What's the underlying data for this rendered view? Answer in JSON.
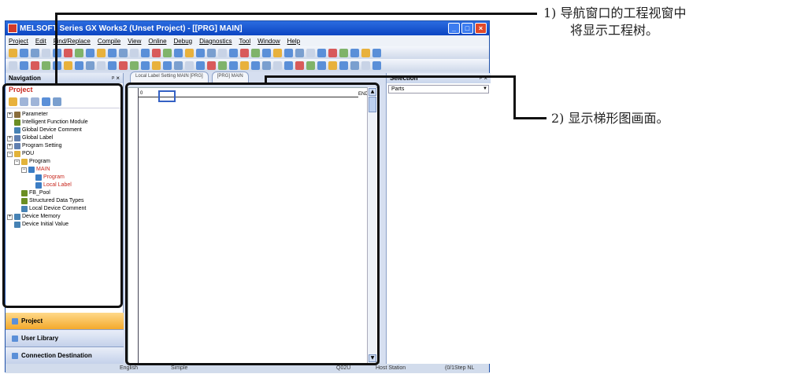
{
  "window": {
    "title": "MELSOFT Series GX Works2 (Unset Project) - [[PRG] MAIN]"
  },
  "menu": [
    "Project",
    "Edit",
    "Find/Replace",
    "Compile",
    "View",
    "Online",
    "Debug",
    "Diagnostics",
    "Tool",
    "Window",
    "Help"
  ],
  "menu_right": "_ ฮ ×",
  "navigation": {
    "header": "Navigation",
    "close": "ᵖ ×",
    "project_title": "Project"
  },
  "tree": [
    {
      "label": "Parameter",
      "depth": 0,
      "expander": "+",
      "color": "#8a6d3b"
    },
    {
      "label": "Intelligent Function Module",
      "depth": 0,
      "expander": "",
      "color": "#6b8e23"
    },
    {
      "label": "Global Device Comment",
      "depth": 0,
      "expander": "",
      "color": "#4682b4"
    },
    {
      "label": "Global Label",
      "depth": 0,
      "expander": "+",
      "color": "#5f7fb0"
    },
    {
      "label": "Program Setting",
      "depth": 0,
      "expander": "+",
      "color": "#5f7fb0"
    },
    {
      "label": "POU",
      "depth": 0,
      "expander": "−",
      "color": "#e2b33a"
    },
    {
      "label": "Program",
      "depth": 1,
      "expander": "−",
      "color": "#e2b33a"
    },
    {
      "label": "MAIN",
      "depth": 2,
      "expander": "−",
      "color": "#3b7dc4",
      "red": true
    },
    {
      "label": "Program",
      "depth": 3,
      "expander": "",
      "color": "#3b7dc4",
      "red": true
    },
    {
      "label": "Local Label",
      "depth": 3,
      "expander": "",
      "color": "#3b7dc4",
      "red": true
    },
    {
      "label": "FB_Pool",
      "depth": 1,
      "expander": "",
      "color": "#6b8e23"
    },
    {
      "label": "Structured Data Types",
      "depth": 1,
      "expander": "",
      "color": "#6b8e23"
    },
    {
      "label": "Local Device Comment",
      "depth": 1,
      "expander": "",
      "color": "#4682b4"
    },
    {
      "label": "Device Memory",
      "depth": 0,
      "expander": "+",
      "color": "#4682b4"
    },
    {
      "label": "Device Initial Value",
      "depth": 0,
      "expander": "",
      "color": "#4682b4"
    }
  ],
  "bottom_tabs": [
    {
      "label": "Project",
      "active": true
    },
    {
      "label": "User Library",
      "active": false
    },
    {
      "label": "Connection Destination",
      "active": false
    }
  ],
  "doc_tabs": [
    "Local Label Setting MAIN [PRG]",
    "[PRG] MAIN"
  ],
  "ladder": {
    "step": "0",
    "end_label": "END"
  },
  "selection": {
    "header": "Selection",
    "dropdown": "Parts"
  },
  "status": {
    "lang": "English",
    "mode": "Simple",
    "cpu": "Q02U",
    "station": "Host Station",
    "step": "(0/1Step NL"
  },
  "callouts": [
    {
      "num": "1)",
      "line1": "导航窗口的工程视窗中",
      "line2": "将显示工程树。"
    },
    {
      "num": "2)",
      "line1": "显示梯形图画面。",
      "line2": ""
    }
  ]
}
